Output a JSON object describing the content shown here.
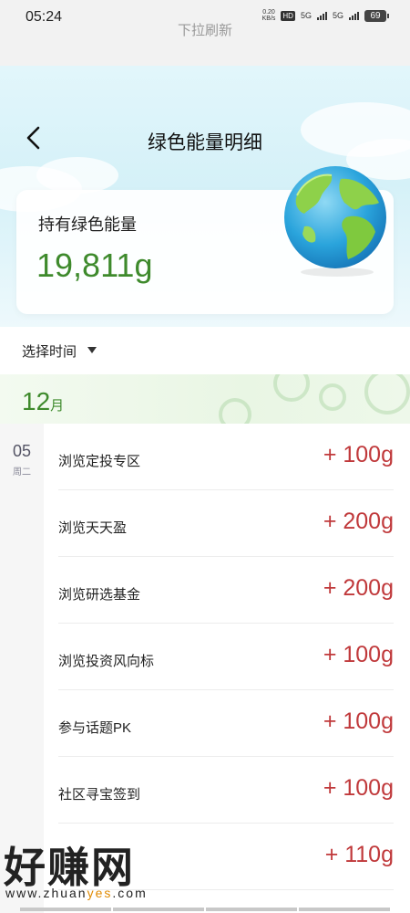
{
  "status_bar": {
    "time": "05:24",
    "pull_hint": "下拉刷新",
    "net_speed": "0.20",
    "net_unit": "KB/s",
    "hd": "HD",
    "sim1": "5G",
    "sim2": "5G",
    "battery": "69"
  },
  "header": {
    "back_icon": "chevron-left-icon",
    "title": "绿色能量明细"
  },
  "summary": {
    "label": "持有绿色能量",
    "value": "19,811g",
    "illustration": "globe-icon"
  },
  "filter": {
    "label": "选择时间",
    "icon": "caret-down-icon"
  },
  "month": {
    "number": "12",
    "unit": "月"
  },
  "day_group": {
    "day": "05",
    "weekday": "周二"
  },
  "records": [
    {
      "name": "浏览定投专区",
      "amount": "+ 100g"
    },
    {
      "name": "浏览天天盈",
      "amount": "+ 200g"
    },
    {
      "name": "浏览研选基金",
      "amount": "+ 200g"
    },
    {
      "name": "浏览投资风向标",
      "amount": "+ 100g"
    },
    {
      "name": "参与话题PK",
      "amount": "+ 100g"
    },
    {
      "name": "社区寻宝签到",
      "amount": "+ 100g"
    },
    {
      "name": "",
      "amount": "+ 110g"
    }
  ],
  "watermark": {
    "text": "好赚网",
    "url_prefix": "www.zhuan",
    "url_highlight": "yes",
    "url_suffix": ".com"
  },
  "colors": {
    "energy_green": "#3e8a2c",
    "amount_red": "#c0393b",
    "sky": "#d5f1f8"
  }
}
